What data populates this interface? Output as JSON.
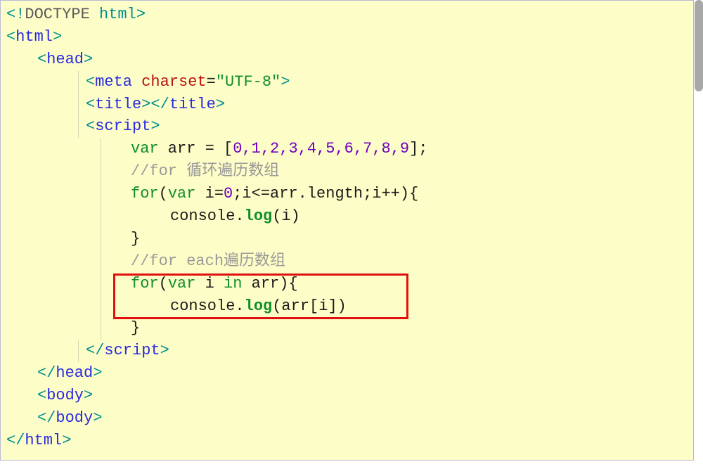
{
  "code": {
    "line1": {
      "open": "<!",
      "doctype": "DOCTYPE",
      "html": " html",
      "close": ">"
    },
    "line2": {
      "open": "<",
      "tag": "html",
      "close": ">"
    },
    "line3": {
      "open": "<",
      "tag": "head",
      "close": ">"
    },
    "line4": {
      "open": "<",
      "tag": "meta",
      "space": " ",
      "attr": "charset",
      "eq": "=",
      "val": "\"UTF-8\"",
      "close": ">"
    },
    "line5": {
      "open1": "<",
      "tag1": "title",
      "close1": ">",
      "open2": "</",
      "tag2": "title",
      "close2": ">"
    },
    "line6": {
      "open": "<",
      "tag": "script",
      "close": ">"
    },
    "line7": {
      "kw": "var",
      "mid": " arr = [",
      "nums": "0,1,2,3,4,5,6,7,8,9",
      "end": "];"
    },
    "line8": {
      "comment": "//for 循环遍历数组"
    },
    "line9": {
      "kw1": "for",
      "p1": "(",
      "kw2": "var",
      "p2": " i=",
      "num": "0",
      "p3": ";i<=arr.length;i++){"
    },
    "line10": {
      "pre": "console.",
      "fn": "log",
      "post": "(i)"
    },
    "line11": {
      "brace": "}"
    },
    "line12": {
      "comment": "//for each遍历数组"
    },
    "line13": {
      "kw1": "for",
      "p1": "(",
      "kw2": "var",
      "p2": " i ",
      "kw3": "in",
      "p3": " arr){"
    },
    "line14": {
      "pre": "console.",
      "fn": "log",
      "post": "(arr[i])"
    },
    "line15": {
      "brace": "}"
    },
    "line16": {
      "open": "</",
      "tag": "script",
      "close": ">"
    },
    "line17": {
      "open": "</",
      "tag": "head",
      "close": ">"
    },
    "line18": {
      "open": "<",
      "tag": "body",
      "close": ">"
    },
    "line19": {
      "open": "</",
      "tag": "body",
      "close": ">"
    },
    "line20": {
      "open": "</",
      "tag": "html",
      "close": ">"
    }
  }
}
